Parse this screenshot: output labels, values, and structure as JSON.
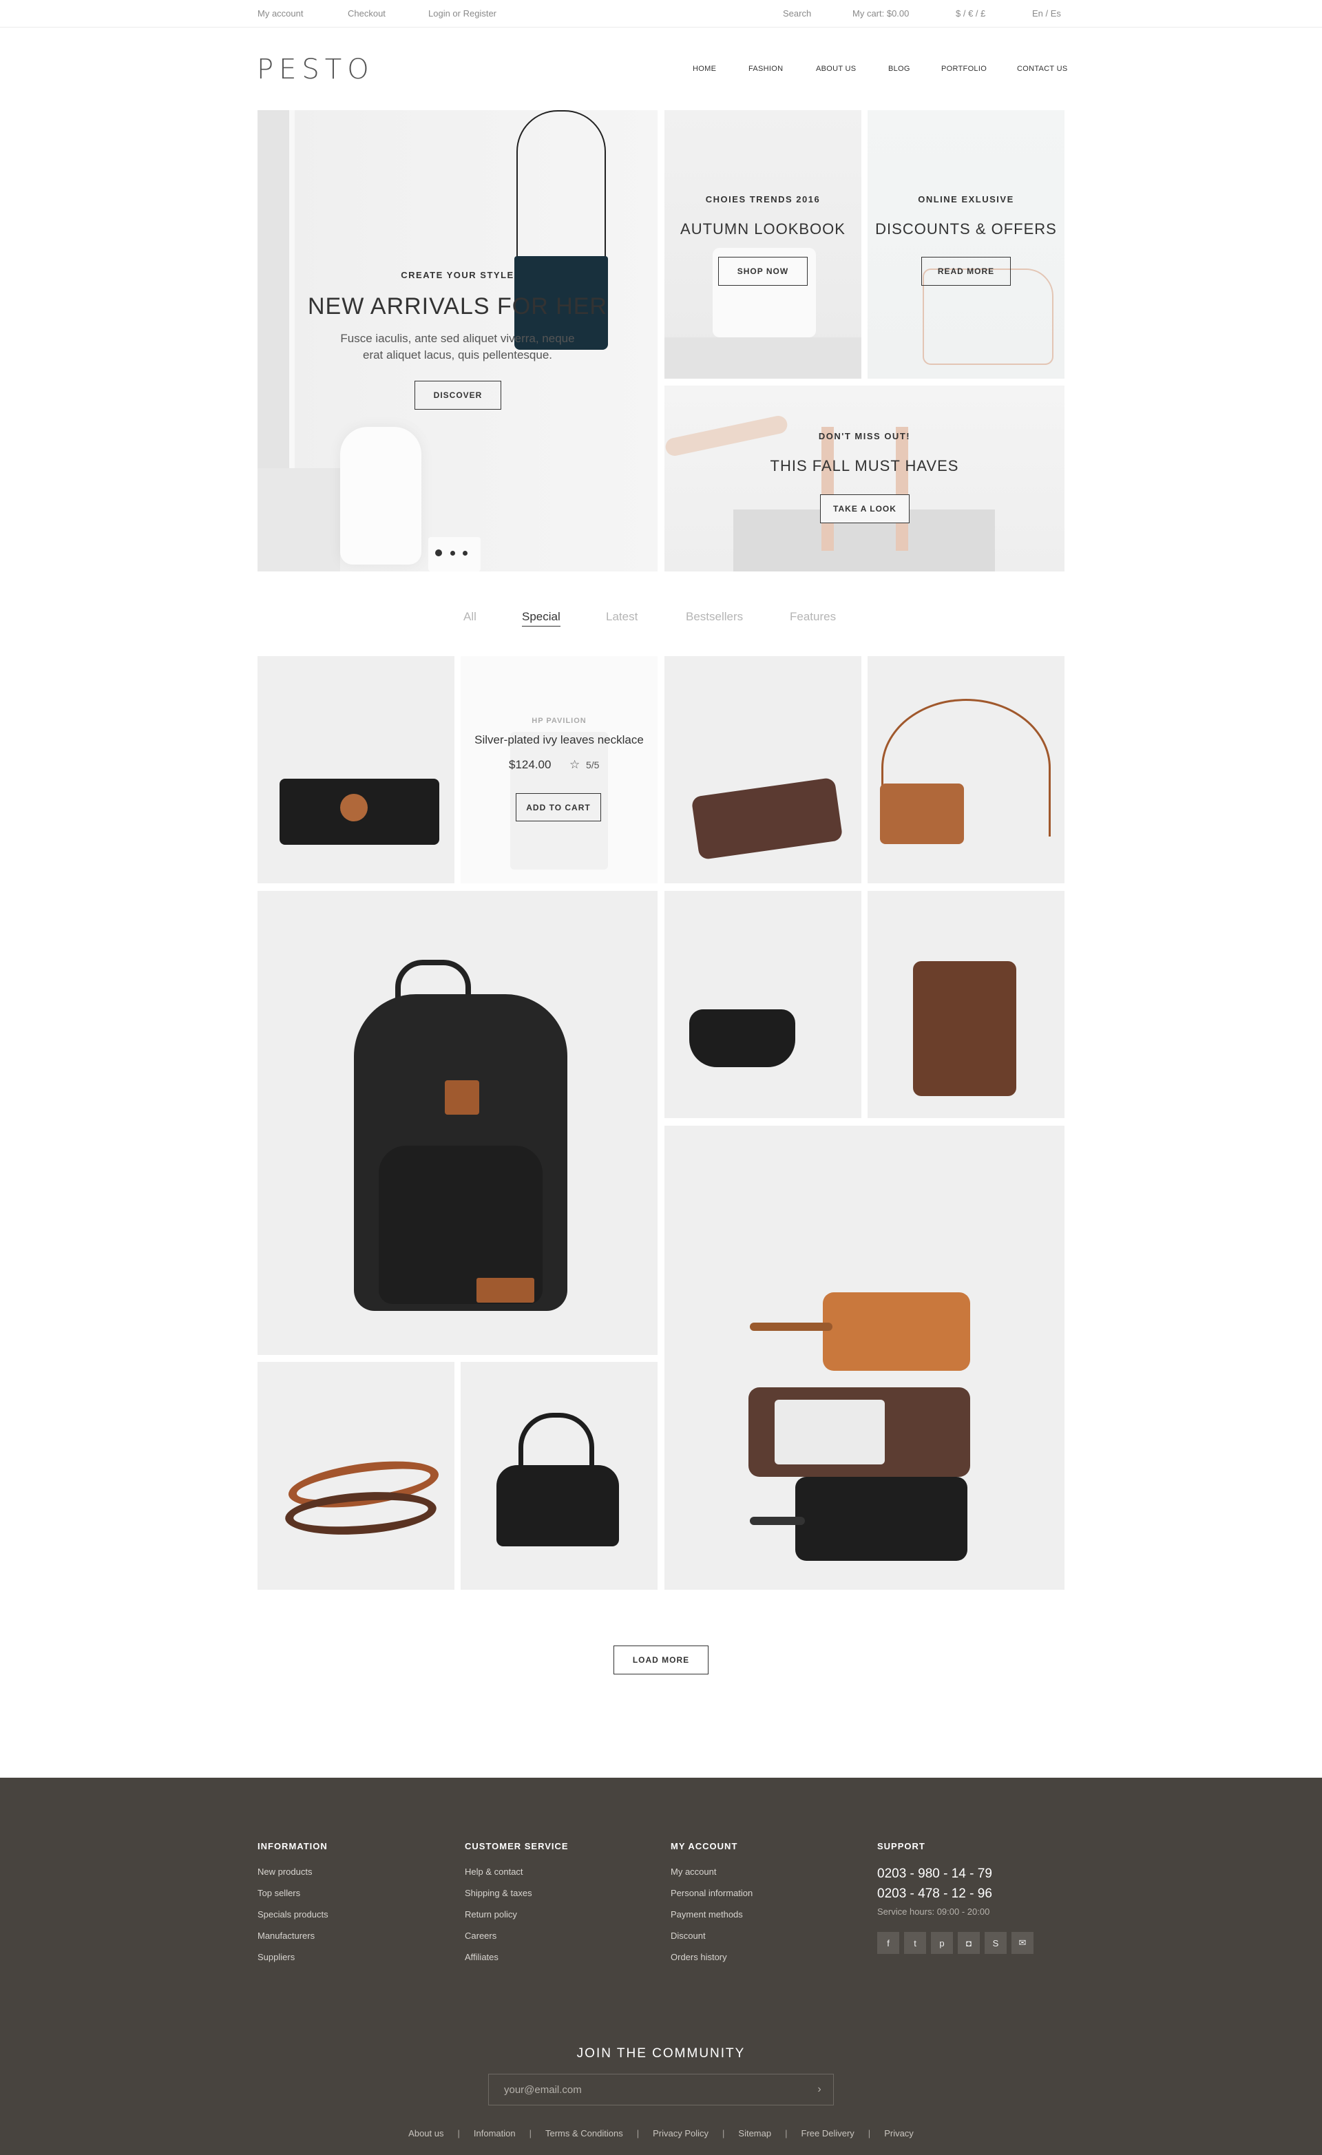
{
  "topbar": {
    "my_account": "My account",
    "checkout": "Checkout",
    "login": "Login or Register",
    "search": "Search",
    "cart": "My cart: $0.00",
    "currency": "$ / € / £",
    "language": "En / Es"
  },
  "header": {
    "logo": "PESTO",
    "nav": [
      "HOME",
      "FASHION",
      "ABOUT US",
      "BLOG",
      "PORTFOLIO",
      "CONTACT US"
    ]
  },
  "hero": {
    "main": {
      "eyebrow": "CREATE YOUR STYLE",
      "title": "NEW ARRIVALS FOR HER",
      "text_line1": "Fusce iaculis, ante sed aliquet viverra, neque",
      "text_line2": "erat aliquet lacus, quis pellentesque.",
      "button": "DISCOVER",
      "slide_count": 3,
      "active_slide": 1
    },
    "lookbook": {
      "eyebrow": "CHOIES TRENDS 2016",
      "title": "AUTUMN LOOKBOOK",
      "button": "SHOP NOW"
    },
    "offers": {
      "eyebrow": "ONLINE EXLUSIVE",
      "title": "DISCOUNTS & OFFERS",
      "button": "READ MORE"
    },
    "musthaves": {
      "eyebrow": "DON'T MISS OUT!",
      "title": "THIS FALL MUST HAVES",
      "button": "TAKE A LOOK"
    }
  },
  "filters": {
    "tabs": [
      "All",
      "Special",
      "Latest",
      "Bestsellers",
      "Features"
    ],
    "active": "Special"
  },
  "products": {
    "hover_card": {
      "brand": "HP PAVILION",
      "title": "Silver-plated ivy leaves necklace",
      "price": "$124.00",
      "rating": "5/5",
      "button": "ADD TO CART"
    },
    "load_more": "LOAD MORE"
  },
  "footer": {
    "information": {
      "title": "INFORMATION",
      "links": [
        "New products",
        "Top sellers",
        "Specials products",
        "Manufacturers",
        "Suppliers"
      ]
    },
    "customer_service": {
      "title": "CUSTOMER SERVICE",
      "links": [
        "Help & contact",
        "Shipping & taxes",
        "Return policy",
        "Careers",
        "Affiliates"
      ]
    },
    "my_account": {
      "title": "MY ACCOUNT",
      "links": [
        "My account",
        "Personal information",
        "Payment methods",
        "Discount",
        "Orders history"
      ]
    },
    "support": {
      "title": "SUPPORT",
      "phone1": "0203 - 980 - 14 - 79",
      "phone2": "0203 - 478 - 12 - 96",
      "hours": "Service hours: 09:00 - 20:00",
      "socials": [
        "facebook-icon",
        "twitter-icon",
        "pinterest-icon",
        "instagram-icon",
        "skype-icon",
        "email-icon"
      ]
    },
    "join": {
      "title": "JOIN THE COMMUNITY",
      "placeholder": "your@email.com"
    },
    "bottom_links": [
      "About us",
      "Infomation",
      "Terms & Conditions",
      "Privacy Policy",
      "Sitemap",
      "Free Delivery",
      "Privacy"
    ]
  },
  "colors": {
    "footer_bg": "#48443f",
    "text_dark": "#333333",
    "tile_bg": "#efefef",
    "leather_brown": "#6b3f2b",
    "leather_tan": "#b0683a",
    "leather_black": "#1d1d1d"
  }
}
